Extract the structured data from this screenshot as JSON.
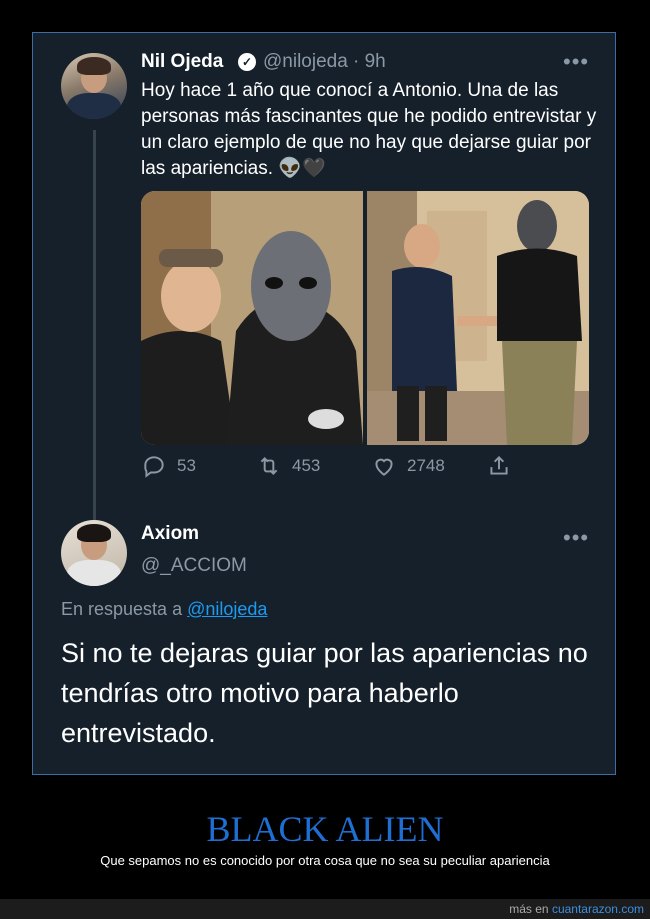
{
  "tweet": {
    "author_name": "Nil Ojeda",
    "author_handle": "@nilojeda",
    "time": "· 9h",
    "more": "•••",
    "text": "Hoy hace 1 año que conocí a Antonio. Una de las personas más fascinantes que he podido entrevistar y un claro ejemplo de que no hay que dejarse guiar por las apariencias. 👽🖤",
    "replies": "53",
    "retweets": "453",
    "likes": "2748"
  },
  "reply": {
    "author_name": "Axiom",
    "author_handle": "@_ACCIOM",
    "more": "•••",
    "in_reply_prefix": "En respuesta a",
    "in_reply_handle": "@nilojeda",
    "text": "Si no te dejaras guiar por las apariencias no tendrías otro motivo para haberlo entrevistado."
  },
  "caption": {
    "title": "BLACK ALIEN",
    "subtitle": "Que sepamos no es conocido por otra cosa que no sea su peculiar apariencia"
  },
  "footer": {
    "prefix": "más en",
    "site": "cuantarazon.com"
  },
  "colors": {
    "background": "#15202b",
    "accent": "#1d9bf0",
    "muted": "#8b98a5",
    "caption_title": "#1f6fd2"
  }
}
